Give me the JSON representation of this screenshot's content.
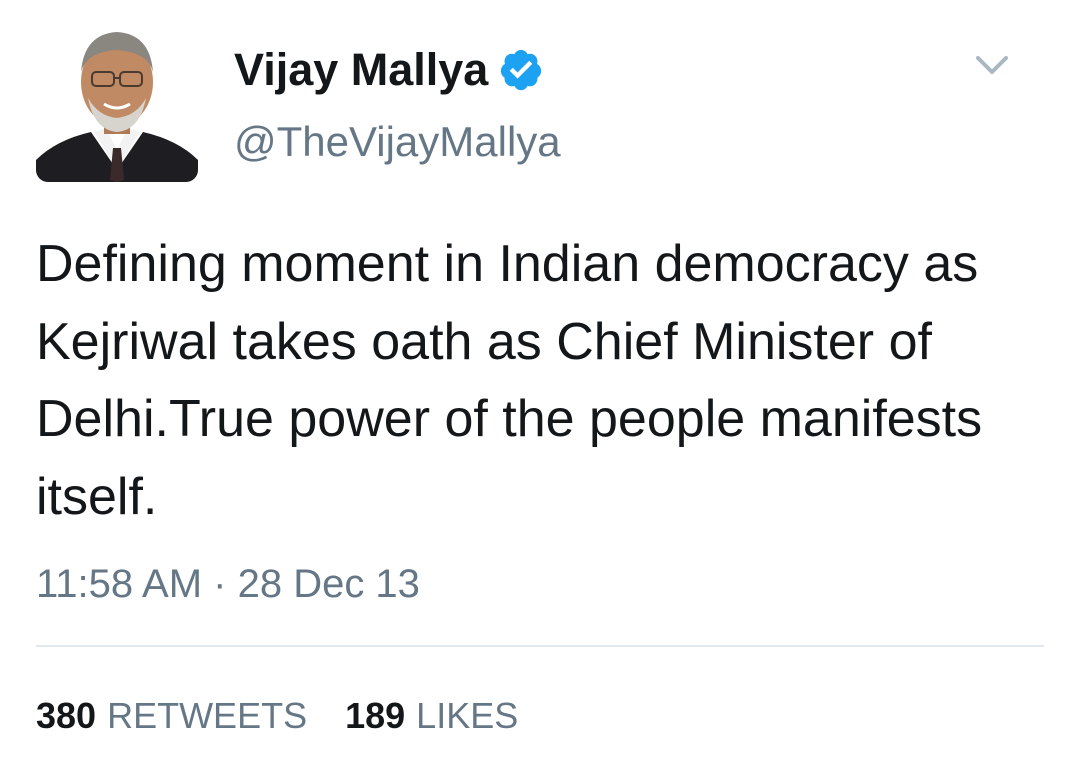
{
  "tweet": {
    "author": {
      "display_name": "Vijay Mallya",
      "handle": "@TheVijayMallya",
      "verified_icon": "verified-badge-icon",
      "avatar": "profile-photo"
    },
    "menu_icon": "chevron-down-icon",
    "text": "Defining moment in Indian democracy as Kejriwal takes oath as Chief Minister of Delhi.True power of the people manifests itself.",
    "timestamp": "11:58 AM · 28 Dec 13",
    "stats": {
      "retweets_count": "380",
      "retweets_label": "RETWEETS",
      "likes_count": "189",
      "likes_label": "LIKES"
    }
  },
  "colors": {
    "text_primary": "#14171a",
    "text_secondary": "#657786",
    "verified_blue": "#1da1f2",
    "divider": "#e1e8ed"
  }
}
